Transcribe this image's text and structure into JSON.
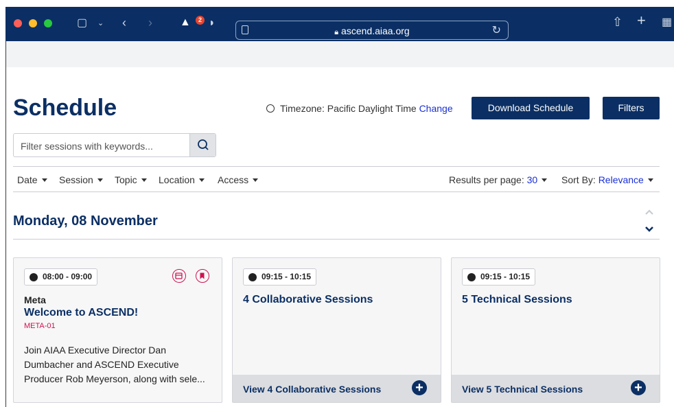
{
  "browser": {
    "url": "ascend.aiaa.org",
    "notification_count": "2"
  },
  "page": {
    "title": "Schedule",
    "timezone_label": "Timezone: Pacific Daylight Time",
    "timezone_change": "Change",
    "download_button": "Download Schedule",
    "filters_button": "Filters"
  },
  "search": {
    "placeholder": "Filter sessions with keywords..."
  },
  "filters": {
    "date": "Date",
    "session": "Session",
    "topic": "Topic",
    "location": "Location",
    "access": "Access",
    "results_label": "Results per page:",
    "results_value": "30",
    "sort_label": "Sort By:",
    "sort_value": "Relevance"
  },
  "day": {
    "heading": "Monday, 08 November"
  },
  "cards": [
    {
      "time": "08:00 - 09:00",
      "category": "Meta",
      "title": "Welcome to ASCEND!",
      "code": "META-01",
      "description": "Join AIAA Executive Director Dan Dumbacher and ASCEND Executive Producer Rob Meyerson, along with sele..."
    },
    {
      "time": "09:15 - 10:15",
      "title": "4 Collaborative Sessions",
      "footer": "View 4 Collaborative Sessions"
    },
    {
      "time": "09:15 - 10:15",
      "title": "5 Technical Sessions",
      "footer": "View 5 Technical Sessions"
    }
  ],
  "colors": {
    "brand_navy": "#0b2f64",
    "link_blue": "#1a2fd4",
    "accent_pink": "#d0124f"
  }
}
